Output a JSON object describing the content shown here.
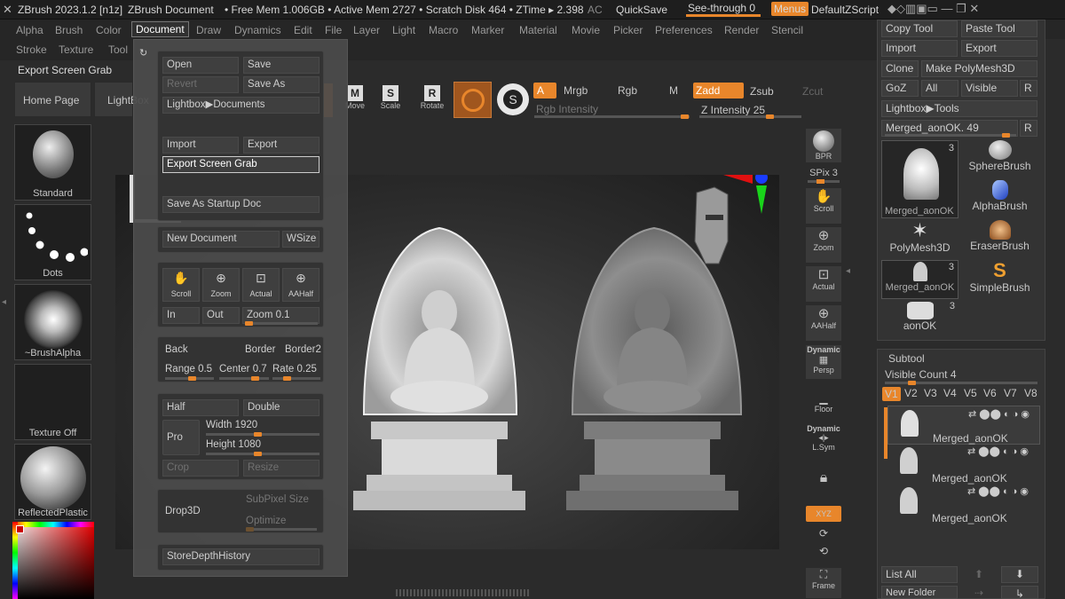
{
  "titlebar": {
    "app": "ZBrush 2023.1.2 [n1z]",
    "doc": "ZBrush Document",
    "mem": "• Free Mem 1.006GB • Active Mem 2727 • Scratch Disk 464 • ZTime ▸ 2.398",
    "ac": "AC",
    "quicksave": "QuickSave",
    "seethrough": "See-through  0",
    "menus": "Menus",
    "script": "DefaultZScript"
  },
  "menubar": [
    "Alpha",
    "Brush",
    "Color",
    "Document",
    "Draw",
    "Dynamics",
    "Edit",
    "File",
    "Layer",
    "Light",
    "Macro",
    "Marker",
    "Material",
    "Movie",
    "Picker",
    "Preferences",
    "Render",
    "Stencil"
  ],
  "menubar2": [
    "Stroke",
    "Texture",
    "Tool"
  ],
  "left": {
    "export_label": "Export Screen Grab",
    "home": "Home Page",
    "lightbox": "LightBox",
    "tiles": [
      "Standard",
      "Dots",
      "~BrushAlpha",
      "Texture Off",
      "ReflectedPlastic"
    ]
  },
  "docmenu": {
    "open": "Open",
    "save": "Save",
    "revert": "Revert",
    "saveas": "Save As",
    "lightbox_docs": "Lightbox▶Documents",
    "import": "Import",
    "export": "Export",
    "export_grab": "Export Screen Grab",
    "startup": "Save As Startup Doc",
    "newdoc": "New Document",
    "wsize": "WSize",
    "scroll": "Scroll",
    "zoom": "Zoom",
    "actual": "Actual",
    "aahalf": "AAHalf",
    "in": "In",
    "out": "Out",
    "zoomval": "Zoom 0.1",
    "back": "Back",
    "border": "Border",
    "border2": "Border2",
    "range": "Range 0.5",
    "center": "Center 0.7",
    "rate": "Rate 0.25",
    "half": "Half",
    "double": "Double",
    "pro": "Pro",
    "width": "Width 1920",
    "height": "Height 1080",
    "crop": "Crop",
    "resize": "Resize",
    "drop3d": "Drop3D",
    "subpixel": "SubPixel Size",
    "optimize": "Optimize",
    "storedepth": "StoreDepthHistory"
  },
  "toprow": {
    "move": "Move",
    "scale": "Scale",
    "rotate": "Rotate",
    "a": "A",
    "mrgb": "Mrgb",
    "rgb": "Rgb",
    "m": "M",
    "zadd": "Zadd",
    "zsub": "Zsub",
    "zcut": "Zcut",
    "rgbint": "Rgb Intensity",
    "zint": "Z Intensity 25"
  },
  "rshelf": [
    "BPR",
    "SPix 3",
    "Scroll",
    "Zoom",
    "Actual",
    "AAHalf",
    "Dynamic",
    "Persp",
    "Floor",
    "Dynamic",
    "L.Sym",
    "XYZ",
    "Frame"
  ],
  "tools": {
    "copy": "Copy Tool",
    "paste": "Paste Tool",
    "import": "Import",
    "export": "Export",
    "clone": "Clone",
    "polymesh": "Make PolyMesh3D",
    "goz": "GoZ",
    "all": "All",
    "visible": "Visible",
    "r": "R",
    "lightbox_tools": "Lightbox▶Tools",
    "merged": "Merged_aonOK. 49",
    "items": [
      "Merged_aonOK",
      "SphereBrush",
      "AlphaBrush",
      "PolyMesh3D",
      "EraserBrush",
      "Merged_aonOK",
      "SimpleBrush",
      "aonOK"
    ],
    "counts": [
      "3",
      "3",
      "3"
    ]
  },
  "subtool": {
    "title": "Subtool",
    "count": "Visible Count 4",
    "versions": [
      "V1",
      "V2",
      "V3",
      "V4",
      "V5",
      "V6",
      "V7",
      "V8"
    ],
    "items": [
      "Merged_aonOK",
      "Merged_aonOK",
      "Merged_aonOK"
    ],
    "listall": "List All",
    "newfolder": "New Folder"
  },
  "colors": {
    "accent": "#e8862b",
    "panel": "#333333",
    "bg": "#2b2b2b"
  }
}
